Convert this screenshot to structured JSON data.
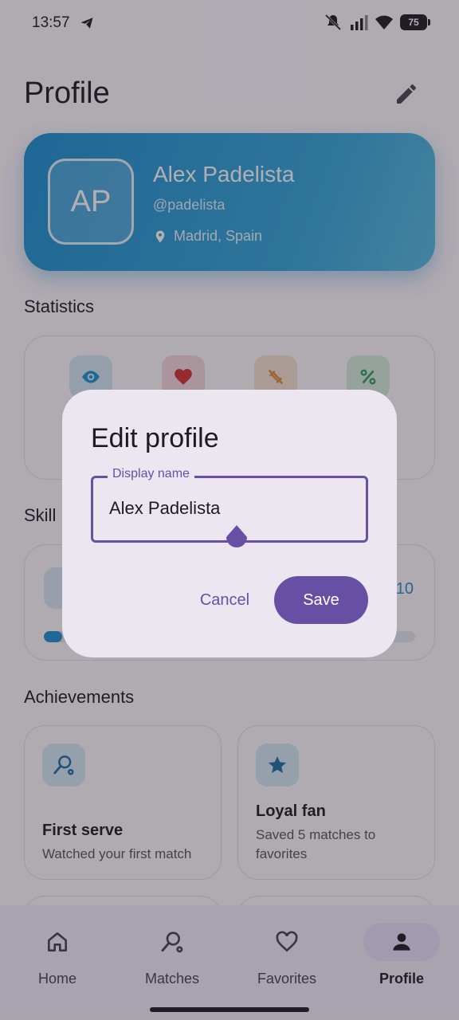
{
  "status_bar": {
    "time": "13:57",
    "battery": "75"
  },
  "header": {
    "title": "Profile"
  },
  "profile": {
    "initials": "AP",
    "name": "Alex Padelista",
    "handle": "@padelista",
    "location": "Madrid, Spain"
  },
  "sections": {
    "statistics": "Statistics",
    "skills": "Skill",
    "achievements": "Achievements"
  },
  "statistics": {
    "icons": [
      "eye-icon",
      "heart-icon",
      "fitness-icon",
      "percent-icon"
    ],
    "colors": [
      "#1b8fcf",
      "#d32f2f",
      "#e08a3a",
      "#2e9d5a"
    ]
  },
  "skills": {
    "value": "10",
    "progress": 0.05
  },
  "achievements": [
    {
      "icon": "racket-icon",
      "title": "First serve",
      "description": "Watched your first match"
    },
    {
      "icon": "star-icon",
      "title": "Loyal fan",
      "description": "Saved 5 matches to favorites"
    }
  ],
  "nav": [
    {
      "label": "Home",
      "icon": "home-icon"
    },
    {
      "label": "Matches",
      "icon": "racket-icon"
    },
    {
      "label": "Favorites",
      "icon": "heart-outline-icon"
    },
    {
      "label": "Profile",
      "icon": "person-icon",
      "active": true
    }
  ],
  "dialog": {
    "title": "Edit profile",
    "field_label": "Display name",
    "field_value": "Alex Padelista",
    "cancel": "Cancel",
    "save": "Save"
  },
  "colors": {
    "primary": "#6750a4",
    "accent": "#1b8fcf"
  }
}
